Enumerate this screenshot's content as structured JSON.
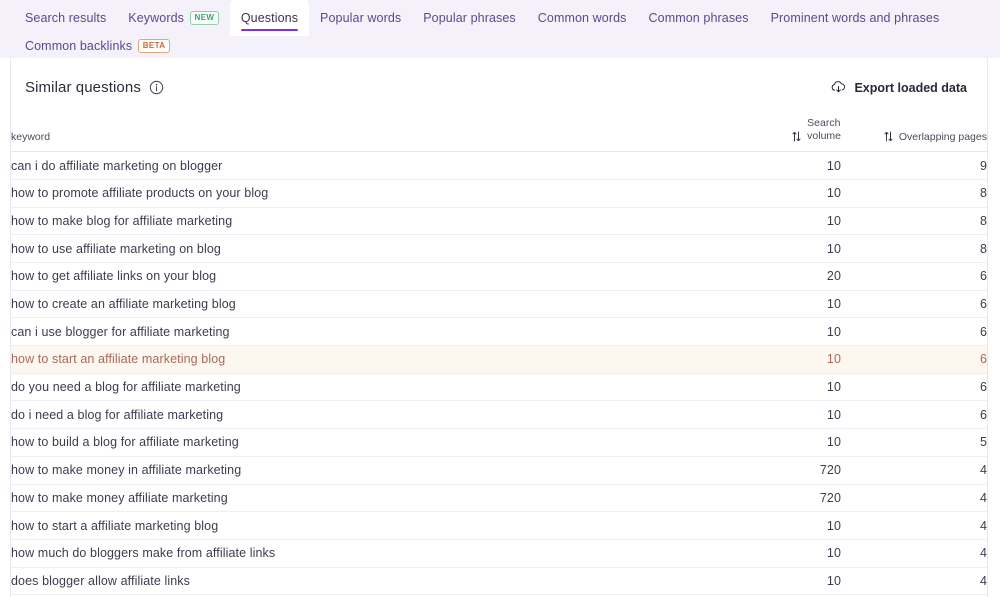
{
  "tabs": {
    "row1": [
      {
        "label": "Search results",
        "active": false,
        "badge": null
      },
      {
        "label": "Keywords",
        "active": false,
        "badge": "NEW",
        "badge_kind": "new"
      },
      {
        "label": "Questions",
        "active": true,
        "badge": null
      },
      {
        "label": "Popular words",
        "active": false,
        "badge": null
      },
      {
        "label": "Popular phrases",
        "active": false,
        "badge": null
      },
      {
        "label": "Common words",
        "active": false,
        "badge": null
      },
      {
        "label": "Common phrases",
        "active": false,
        "badge": null
      },
      {
        "label": "Prominent words and phrases",
        "active": false,
        "badge": null
      }
    ],
    "row2": [
      {
        "label": "Common backlinks",
        "active": false,
        "badge": "BETA",
        "badge_kind": "beta"
      }
    ]
  },
  "panel": {
    "title": "Similar questions",
    "info_icon": "info-icon",
    "export_label": "Export loaded data",
    "export_icon": "cloud-download-icon"
  },
  "table": {
    "columns": {
      "keyword": "keyword",
      "search_volume_line1": "Search",
      "search_volume_line2": "volume",
      "overlapping_pages": "Overlapping pages",
      "sort_icon": "sort-arrows-icon"
    },
    "rows": [
      {
        "keyword": "can i do affiliate marketing on blogger",
        "search_volume": "10",
        "overlapping_pages": "9",
        "highlighted": false
      },
      {
        "keyword": "how to promote affiliate products on your blog",
        "search_volume": "10",
        "overlapping_pages": "8",
        "highlighted": false
      },
      {
        "keyword": "how to make blog for affiliate marketing",
        "search_volume": "10",
        "overlapping_pages": "8",
        "highlighted": false
      },
      {
        "keyword": "how to use affiliate marketing on blog",
        "search_volume": "10",
        "overlapping_pages": "8",
        "highlighted": false
      },
      {
        "keyword": "how to get affiliate links on your blog",
        "search_volume": "20",
        "overlapping_pages": "6",
        "highlighted": false
      },
      {
        "keyword": "how to create an affiliate marketing blog",
        "search_volume": "10",
        "overlapping_pages": "6",
        "highlighted": false
      },
      {
        "keyword": "can i use blogger for affiliate marketing",
        "search_volume": "10",
        "overlapping_pages": "6",
        "highlighted": false
      },
      {
        "keyword": "how to start an affiliate marketing blog",
        "search_volume": "10",
        "overlapping_pages": "6",
        "highlighted": true
      },
      {
        "keyword": "do you need a blog for affiliate marketing",
        "search_volume": "10",
        "overlapping_pages": "6",
        "highlighted": false
      },
      {
        "keyword": "do i need a blog for affiliate marketing",
        "search_volume": "10",
        "overlapping_pages": "6",
        "highlighted": false
      },
      {
        "keyword": "how to build a blog for affiliate marketing",
        "search_volume": "10",
        "overlapping_pages": "5",
        "highlighted": false
      },
      {
        "keyword": "how to make money in affiliate marketing",
        "search_volume": "720",
        "overlapping_pages": "4",
        "highlighted": false
      },
      {
        "keyword": "how to make money affiliate marketing",
        "search_volume": "720",
        "overlapping_pages": "4",
        "highlighted": false
      },
      {
        "keyword": "how to start a affiliate marketing blog",
        "search_volume": "10",
        "overlapping_pages": "4",
        "highlighted": false
      },
      {
        "keyword": "how much do bloggers make from affiliate links",
        "search_volume": "10",
        "overlapping_pages": "4",
        "highlighted": false
      },
      {
        "keyword": "does blogger allow affiliate links",
        "search_volume": "10",
        "overlapping_pages": "4",
        "highlighted": false
      }
    ]
  },
  "colors": {
    "tabbar_bg": "#f4f1fa",
    "tab_text": "#5b4a8a",
    "active_underline": "#7b2ff2",
    "badge_new": "#3f9f6a",
    "badge_beta": "#c2703a",
    "highlight_bg": "#fdf8ef",
    "highlight_text": "#a9685b"
  }
}
